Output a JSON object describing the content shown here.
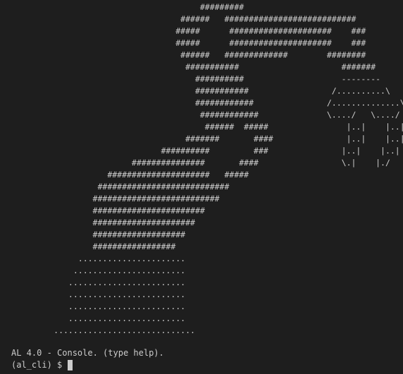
{
  "art_lines": [
    "                                         #########",
    "                                     ######   ###########################",
    "                                    #####      #####################    ###",
    "                                    #####      #####################    ###",
    "                                     ######   #############        ########",
    "                                      ###########                     #######",
    "                                        ##########                    --------",
    "                                        ###########                 /..........\\",
    "                                        ############               /..............\\",
    "                                         ############              \\..../   \\..../",
    "                                          ######  #####                |..|    |..|",
    "                                      #######       ####               |..|    |..|",
    "                                 ##########         ###               |..|    |..|",
    "                           ###############       ####                 \\.|    |./",
    "                      #####################   #####",
    "                    ###########################",
    "                   ##########################",
    "                   #######################",
    "                   #####################",
    "                   ###################",
    "                   #################",
    "                ......................",
    "               .......................",
    "              ........................",
    "              ........................",
    "              ........................",
    "              ........................",
    "           ............................."
  ],
  "banner": "AL 4.0 - Console. (type help).",
  "prompt": {
    "label": "(al_cli) $",
    "input_value": ""
  }
}
